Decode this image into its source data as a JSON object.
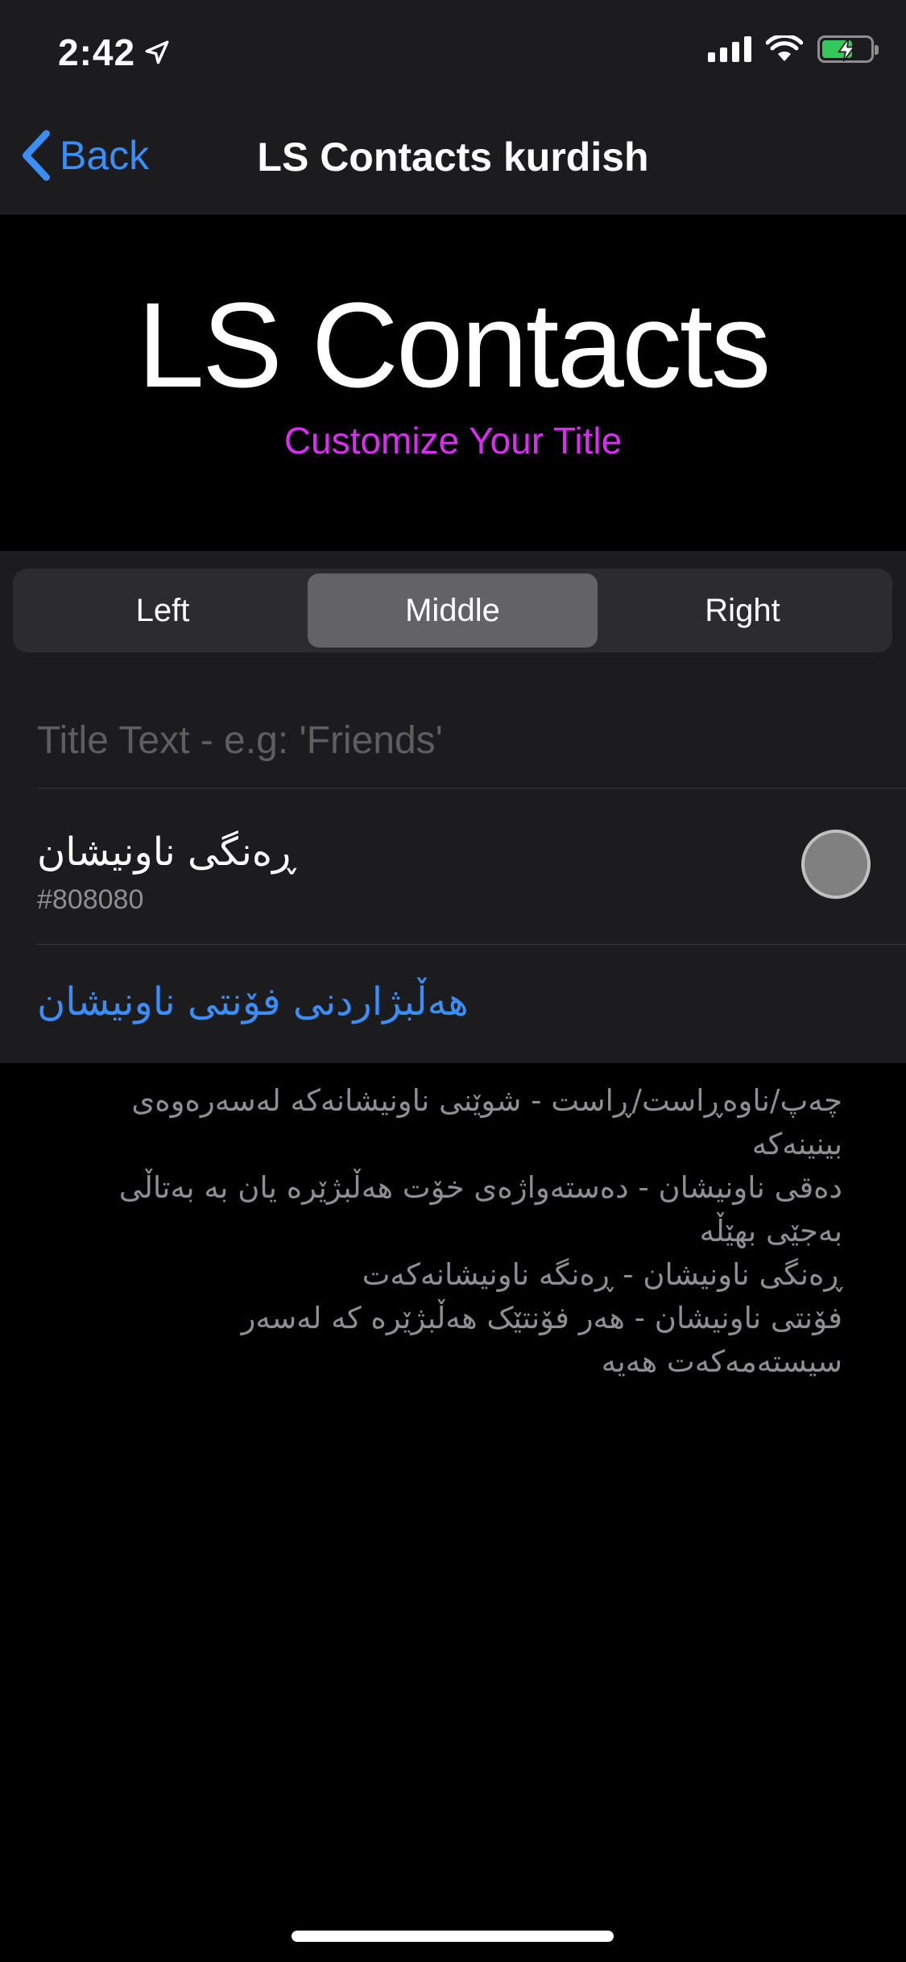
{
  "status_bar": {
    "time": "2:42",
    "location_icon": "location-arrow-icon",
    "signal_icon": "cellular-signal-icon",
    "wifi_icon": "wifi-icon",
    "battery_icon": "battery-charging-icon"
  },
  "nav": {
    "back_label": "Back",
    "title": "LS Contacts kurdish"
  },
  "preview": {
    "title": "LS Contacts",
    "subtitle": "Customize Your Title",
    "subtitle_color": "#d92df2"
  },
  "alignment": {
    "options": [
      "Left",
      "Middle",
      "Right"
    ],
    "selected": "Middle"
  },
  "title_input": {
    "placeholder": "Title Text - e.g: 'Friends'",
    "value": ""
  },
  "title_color": {
    "label": "ڕەنگی ناونیشان",
    "value": "#808080"
  },
  "font_picker": {
    "label": "هەڵبژاردنی فۆنتی ناونیشان"
  },
  "footer_lines": [
    "چەپ/ناوەڕاست/ڕاست - شوێنی ناونیشانەکە لەسەرەوەی بینینەکە",
    "دەقی ناونیشان - دەستەواژەی خۆت هەڵبژێرە یان بە بەتاڵی",
    "بەجێی بهێڵە",
    "ڕەنگی ناونیشان - ڕەنگە ناونیشانەکەت",
    "فۆنتی ناونیشان - هەر فۆنتێک هەڵبژێرە کە لەسەر",
    "سیستەمەکەت هەیە"
  ],
  "accent_color": "#3a8ef6"
}
